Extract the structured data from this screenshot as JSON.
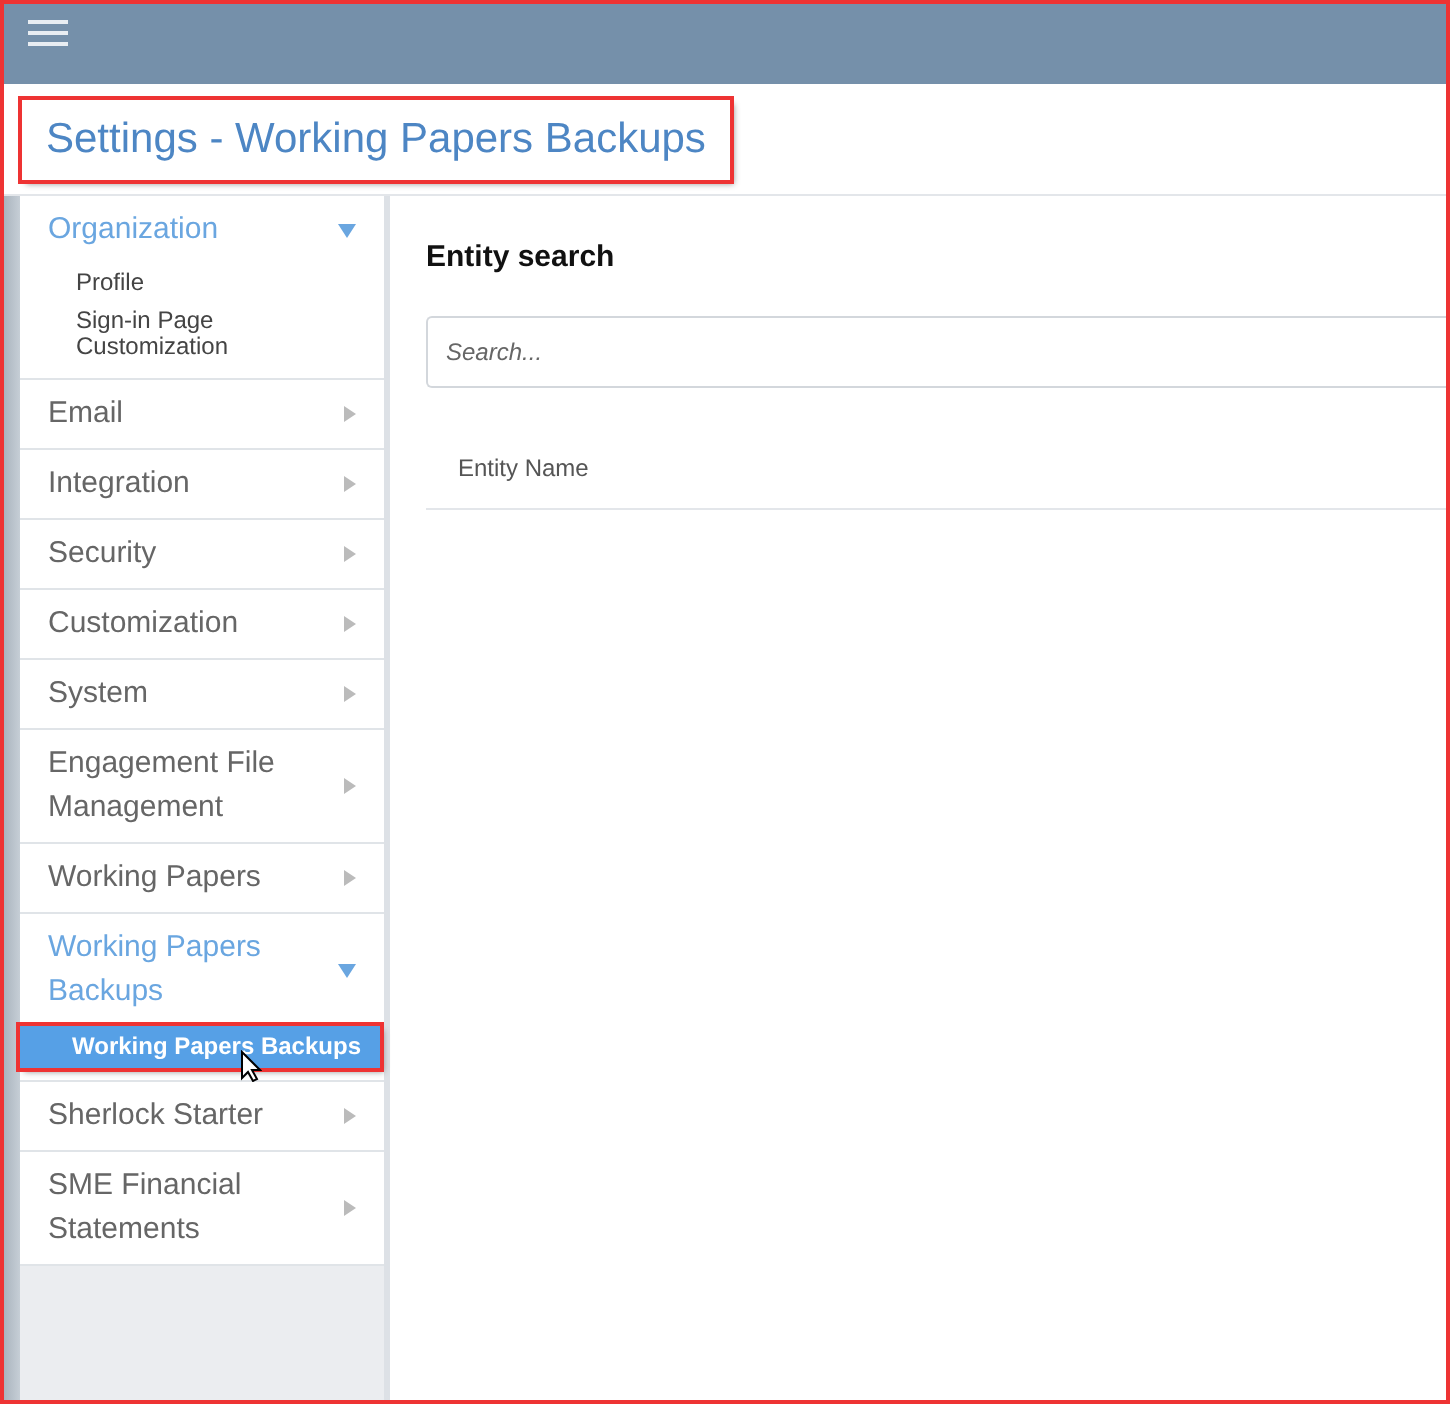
{
  "page_title": "Settings - Working Papers Backups",
  "sidebar": {
    "items": [
      {
        "label": "Organization",
        "expanded": true,
        "children": [
          {
            "label": "Profile",
            "selected": false
          },
          {
            "label": "Sign-in Page Customization",
            "selected": false
          }
        ]
      },
      {
        "label": "Email",
        "expanded": false
      },
      {
        "label": "Integration",
        "expanded": false
      },
      {
        "label": "Security",
        "expanded": false
      },
      {
        "label": "Customization",
        "expanded": false
      },
      {
        "label": "System",
        "expanded": false
      },
      {
        "label": "Engagement File Management",
        "expanded": false
      },
      {
        "label": "Working Papers",
        "expanded": false
      },
      {
        "label": "Working Papers Backups",
        "expanded": true,
        "children": [
          {
            "label": "Working Papers Backups",
            "selected": true
          }
        ]
      },
      {
        "label": "Sherlock Starter",
        "expanded": false
      },
      {
        "label": "SME Financial Statements",
        "expanded": false
      }
    ]
  },
  "content": {
    "heading": "Entity search",
    "search": {
      "placeholder": "Search..."
    },
    "table": {
      "columns": [
        "Entity Name"
      ]
    }
  }
}
